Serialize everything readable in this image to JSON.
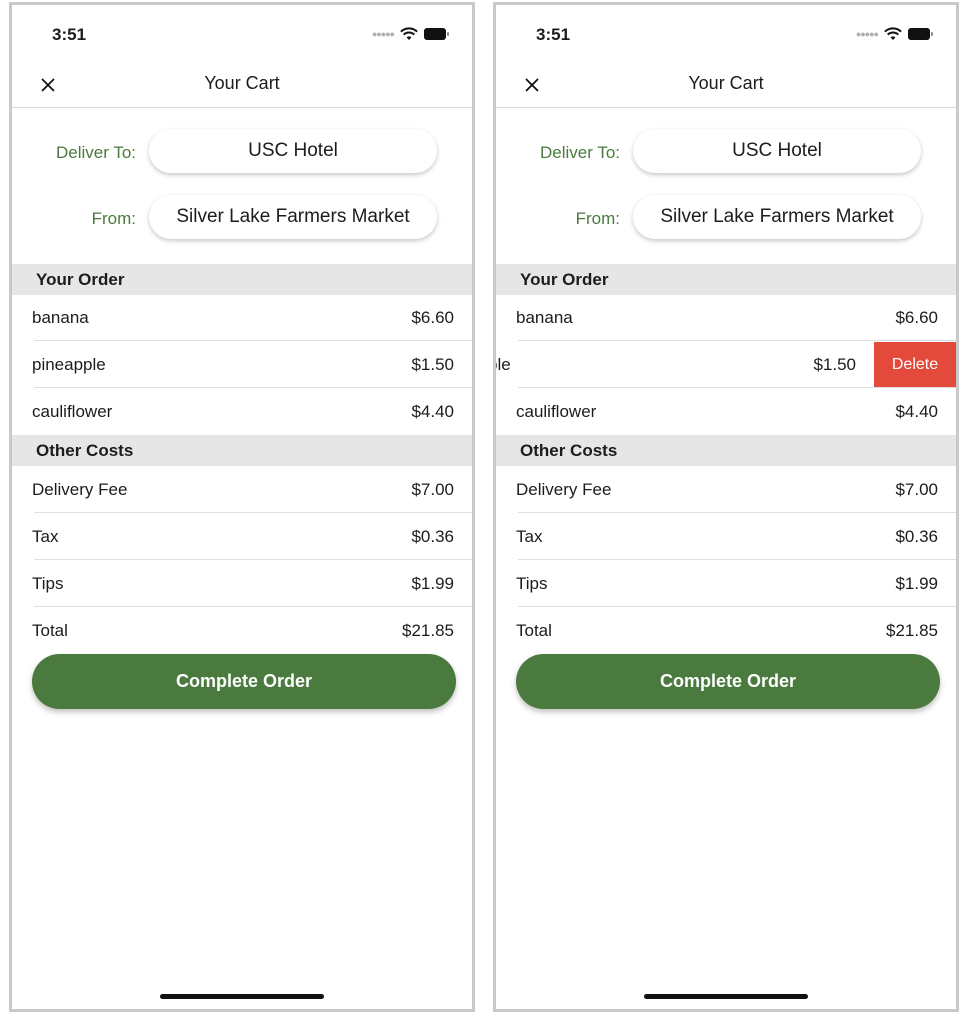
{
  "status": {
    "time": "3:51"
  },
  "nav": {
    "title": "Your Cart"
  },
  "delivery": {
    "deliver_to_label": "Deliver To:",
    "deliver_to_value": "USC Hotel",
    "from_label": "From:",
    "from_value": "Silver Lake Farmers Market"
  },
  "sections": {
    "order": "Your Order",
    "other": "Other Costs"
  },
  "order_items": [
    {
      "name": "banana",
      "price": "$6.60"
    },
    {
      "name": "pineapple",
      "price": "$1.50"
    },
    {
      "name": "cauliflower",
      "price": "$4.40"
    }
  ],
  "other_costs": [
    {
      "name": "Delivery Fee",
      "price": "$7.00"
    },
    {
      "name": "Tax",
      "price": "$0.36"
    },
    {
      "name": "Tips",
      "price": "$1.99"
    },
    {
      "name": "Total",
      "price": "$21.85"
    }
  ],
  "swiped_row": {
    "name_fragment": "ple",
    "price": "$1.50",
    "delete_label": "Delete"
  },
  "complete_label": "Complete Order",
  "colors": {
    "accent": "#4a7a3d",
    "delete": "#e44a3c",
    "section_bg": "#e6e6e6"
  }
}
